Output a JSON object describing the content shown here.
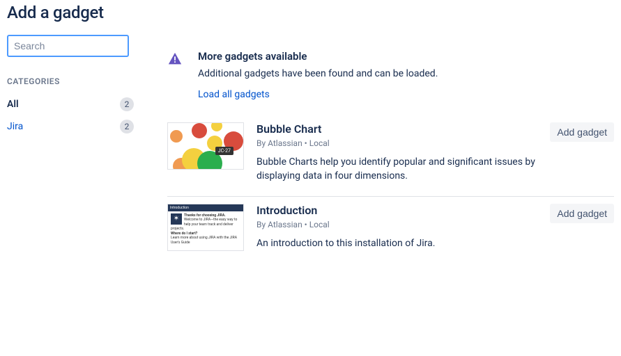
{
  "page": {
    "title": "Add a gadget"
  },
  "search": {
    "placeholder": "Search"
  },
  "sidebar": {
    "categories_label": "CATEGORIES",
    "items": [
      {
        "name": "All",
        "count": "2",
        "selected": true
      },
      {
        "name": "Jira",
        "count": "2",
        "selected": false
      }
    ]
  },
  "notice": {
    "title": "More gadgets available",
    "text": "Additional gadgets have been found and can be loaded.",
    "link": "Load all gadgets"
  },
  "gadgets": [
    {
      "title": "Bubble Chart",
      "meta": "By Atlassian • Local",
      "desc": "Bubble Charts help you identify popular and significant issues by displaying data in four dimensions.",
      "action": "Add gadget",
      "thumb_tag": "JC-27"
    },
    {
      "title": "Introduction",
      "meta": "By Atlassian • Local",
      "desc": "An introduction to this installation of Jira.",
      "action": "Add gadget"
    }
  ]
}
